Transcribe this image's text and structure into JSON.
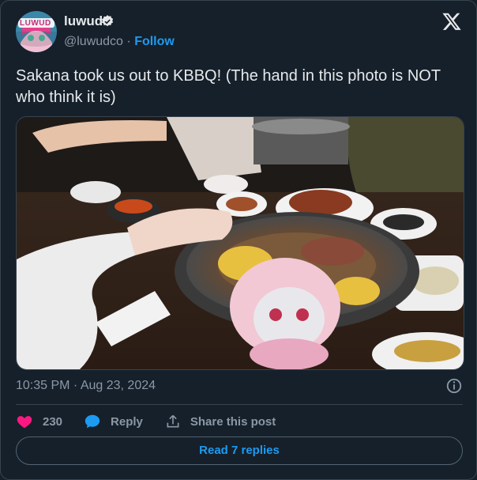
{
  "author": {
    "display_name": "luwud",
    "handle": "@luwudco",
    "separator": "·",
    "follow_label": "Follow",
    "avatar_text": "LUWUD"
  },
  "tweet": {
    "text": "Sakana took us out to KBBQ! (The hand in this photo is NOT who think it is)",
    "timestamp": "10:35 PM · Aug 23, 2024"
  },
  "actions": {
    "like_count": "230",
    "reply_label": "Reply",
    "share_label": "Share this post"
  },
  "read_replies_label": "Read 7 replies",
  "colors": {
    "background": "#15202b",
    "accent": "#1d9bf0",
    "like": "#f91880",
    "muted": "#8b98a5",
    "text": "#e7e9ea",
    "border": "#38444d"
  },
  "icons": [
    "verified-badge-icon",
    "x-logo-icon",
    "info-icon",
    "heart-icon",
    "reply-bubble-icon",
    "share-icon"
  ]
}
